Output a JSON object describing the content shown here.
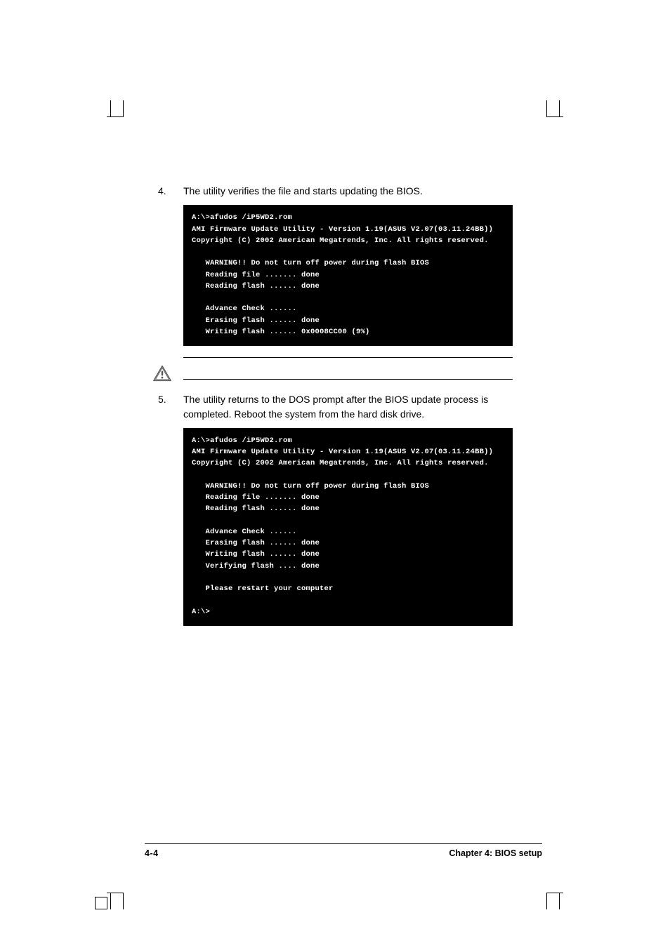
{
  "steps": {
    "s4": {
      "num": "4.",
      "text": "The utility verifies the file and starts updating the BIOS."
    },
    "s5": {
      "num": "5.",
      "text": "The utility returns to the DOS prompt after the BIOS update process is completed. Reboot the system from the hard disk drive."
    }
  },
  "terminal1": {
    "l1": "A:\\>afudos /iP5WD2.rom",
    "l2": "AMI Firmware Update Utility - Version 1.19(ASUS V2.07(03.11.24BB))",
    "l3": "Copyright (C) 2002 American Megatrends, Inc. All rights reserved.",
    "l4": "   WARNING!! Do not turn off power during flash BIOS",
    "l5": "   Reading file ....... done",
    "l6": "   Reading flash ...... done",
    "l7": "   Advance Check ......",
    "l8": "   Erasing flash ...... done",
    "l9": "   Writing flash ...... 0x0008CC00 (9%)"
  },
  "terminal2": {
    "l1": "A:\\>afudos /iP5WD2.rom",
    "l2": "AMI Firmware Update Utility - Version 1.19(ASUS V2.07(03.11.24BB))",
    "l3": "Copyright (C) 2002 American Megatrends, Inc. All rights reserved.",
    "l4": "   WARNING!! Do not turn off power during flash BIOS",
    "l5": "   Reading file ....... done",
    "l6": "   Reading flash ...... done",
    "l7": "   Advance Check ......",
    "l8": "   Erasing flash ...... done",
    "l9": "   Writing flash ...... done",
    "l10": "   Verifying flash .... done",
    "l11": "   Please restart your computer",
    "l12": "A:\\>"
  },
  "footer": {
    "page": "4-4",
    "chapter": "Chapter 4: BIOS setup"
  }
}
